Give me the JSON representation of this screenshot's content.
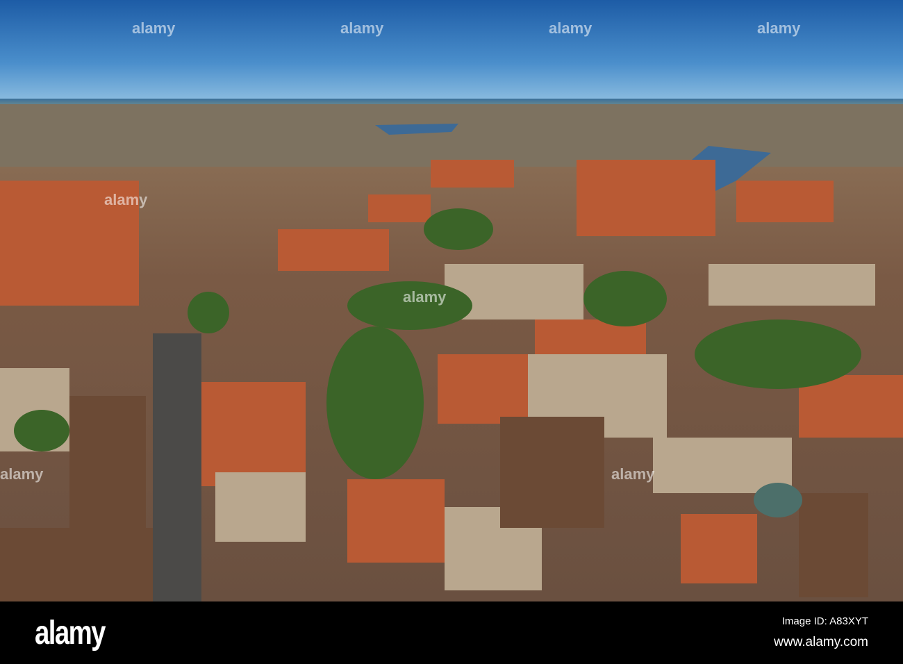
{
  "photo": {
    "subject": "Aerial view of old town with red-roofed buildings, river and port",
    "colors": {
      "sky": "#2f72b8",
      "roof": "#c8643a",
      "tree": "#3c6a2a",
      "river": "#3d6a96"
    }
  },
  "watermark": {
    "text": "alamy"
  },
  "footer": {
    "logo": "alamy",
    "image_id": "Image ID: A83XYT",
    "url": "www.alamy.com"
  }
}
